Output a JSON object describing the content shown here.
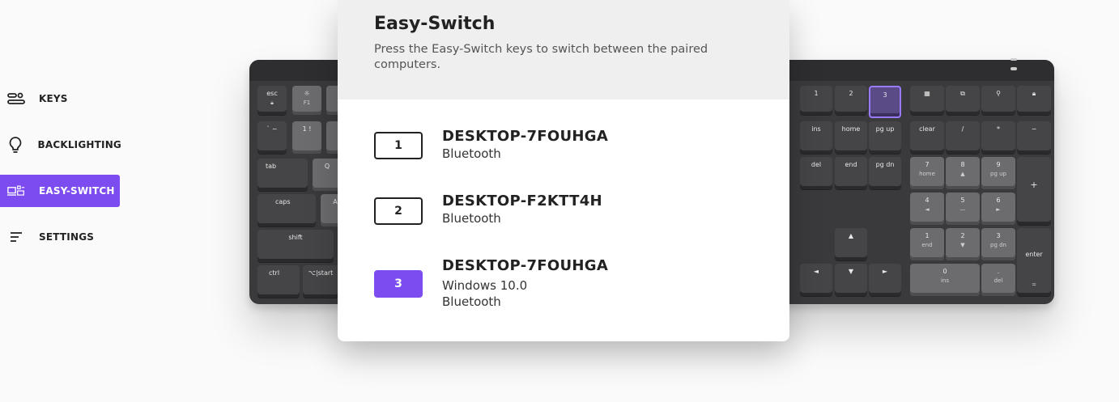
{
  "sidebar": {
    "items": [
      {
        "label": "KEYS",
        "icon": "keys-icon"
      },
      {
        "label": "BACKLIGHTING",
        "icon": "lightbulb-icon"
      },
      {
        "label": "EASY-SWITCH",
        "icon": "easy-switch-icon",
        "active": true
      },
      {
        "label": "SETTINGS",
        "icon": "settings-icon"
      }
    ]
  },
  "modal": {
    "title": "Easy-Switch",
    "description": "Press the Easy-Switch keys to switch between the paired computers.",
    "devices": [
      {
        "slot": "1",
        "name": "DESKTOP-7FOUHGA",
        "lines": [
          "Bluetooth"
        ],
        "active": false
      },
      {
        "slot": "2",
        "name": "DESKTOP-F2KTT4H",
        "lines": [
          "Bluetooth"
        ],
        "active": false
      },
      {
        "slot": "3",
        "name": "DESKTOP-7FOUHGA",
        "lines": [
          "Windows 10.0",
          "Bluetooth"
        ],
        "active": true
      }
    ]
  },
  "keyboard": {
    "left_keys": {
      "esc": "esc",
      "f1": "F1",
      "backtick": "` ~",
      "one": "1 !",
      "tab": "tab",
      "q": "Q",
      "caps": "caps",
      "a": "A",
      "shift": "shift",
      "ctrl": "ctrl",
      "opt": "⌥|start"
    },
    "switch_keys": [
      "1",
      "2",
      "3"
    ],
    "nav_keys": [
      "ins",
      "home",
      "pg up",
      "del",
      "end",
      "pg dn"
    ],
    "numpad": {
      "clear": "clear",
      "div": "/",
      "mul": "*",
      "minus": "−",
      "plus": "+",
      "enter": "enter",
      "n7": "7",
      "n7sub": "home",
      "n8": "8",
      "n8sub": "▲",
      "n9": "9",
      "n9sub": "pg up",
      "n4": "4",
      "n4sub": "◄",
      "n5": "5",
      "n5sub": "—",
      "n6": "6",
      "n6sub": "►",
      "n1": "1",
      "n1sub": "end",
      "n2": "2",
      "n2sub": "▼",
      "n3": "3",
      "n3sub": "pg dn",
      "n0": "0",
      "n0sub": "ins",
      "dot": ".",
      "dotsub": "del",
      "eq": "="
    },
    "arrows": {
      "up": "▲",
      "left": "◄",
      "down": "▼",
      "right": "►"
    }
  }
}
